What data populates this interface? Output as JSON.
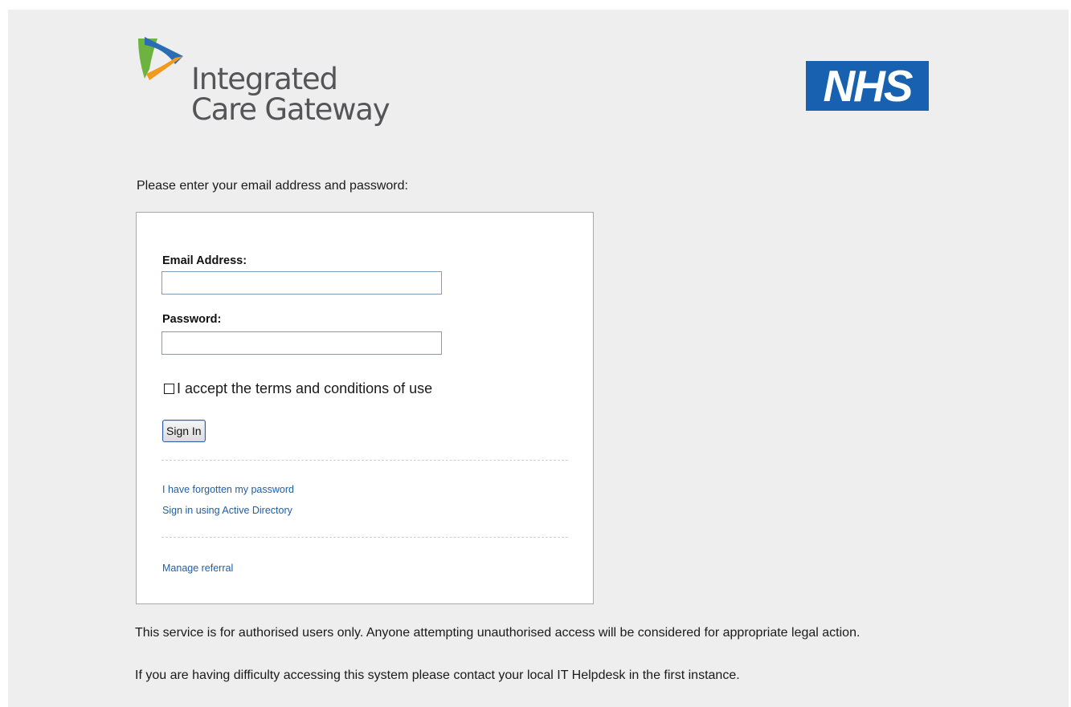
{
  "branding": {
    "logo_line1": "Integrated",
    "logo_line2": "Care Gateway",
    "nhs_logo_text": "NHS",
    "nhs_color": "#1861b0"
  },
  "prompt": "Please enter your email address and password:",
  "form": {
    "email_label": "Email Address:",
    "email_value": "",
    "password_label": "Password:",
    "password_value": "",
    "terms_checked": false,
    "terms_label": "I accept the terms and conditions of use",
    "sign_in_label": "Sign In"
  },
  "links": {
    "forgot_password": "I have forgotten my password",
    "active_directory": "Sign in using Active Directory",
    "manage_referral": "Manage referral",
    "link_color": "#1f5ea8"
  },
  "notices": {
    "authorised": "This service is for authorised users only. Anyone attempting unauthorised access will be considered for appropriate legal action.",
    "helpdesk": "If you are having difficulty accessing this system please contact your local IT Helpdesk in the first instance."
  }
}
